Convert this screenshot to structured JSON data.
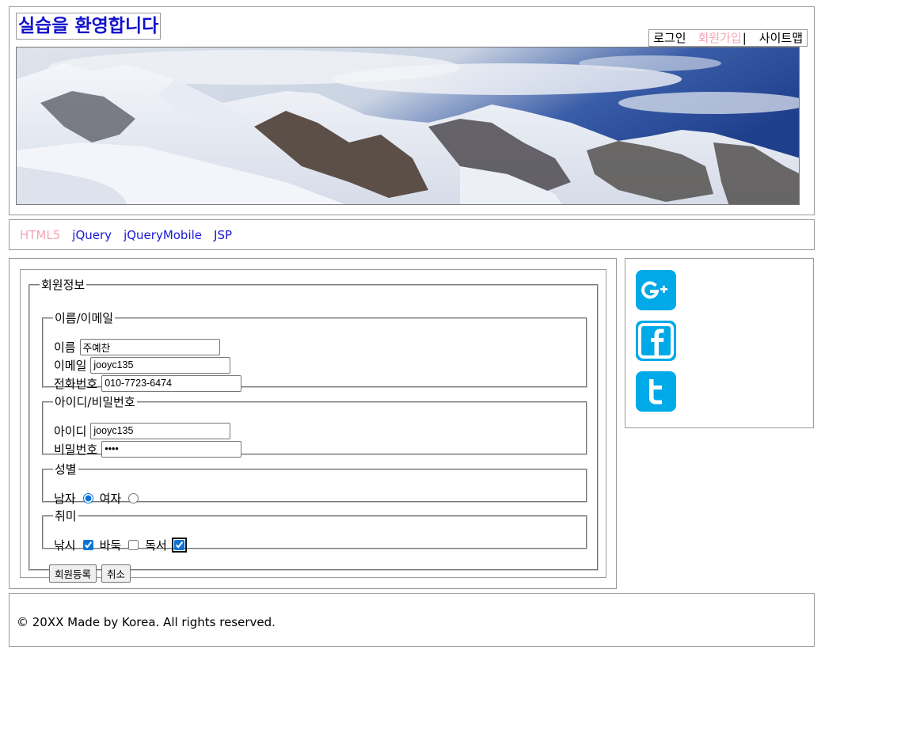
{
  "header": {
    "title": "실습을 환영합니다",
    "top_menu": {
      "login": "로그인",
      "join": "회원가입",
      "separator": "|",
      "sitemap": "사이트맵"
    }
  },
  "nav": {
    "items": [
      "HTML5",
      "jQuery",
      "jQueryMobile",
      "JSP"
    ],
    "active_index": 0
  },
  "form": {
    "legend": "회원정보",
    "name_email": {
      "legend": "이름/이메일",
      "name_label": "이름",
      "name_value": "주예찬",
      "email_label": "이메일",
      "email_value": "jooyc135",
      "phone_label": "전화번호",
      "phone_value": "010-7723-6474"
    },
    "account": {
      "legend": "아이디/비밀번호",
      "id_label": "아이디",
      "id_value": "jooyc135",
      "pw_label": "비밀번호",
      "pw_value": "1234"
    },
    "gender": {
      "legend": "성별",
      "male": "남자",
      "female": "여자",
      "selected": "male"
    },
    "hobby": {
      "legend": "취미",
      "fishing": "낚시",
      "baduk": "바둑",
      "reading": "독서",
      "checked": [
        "fishing",
        "reading"
      ]
    },
    "buttons": {
      "submit": "회원등록",
      "cancel": "취소"
    }
  },
  "aside": {
    "icons": [
      "google-plus-icon",
      "facebook-icon",
      "twitter-icon"
    ],
    "icon_color": "#00a9e8"
  },
  "footer": {
    "text": "© 20XX Made by Korea. All rights reserved."
  },
  "colors": {
    "title": "#1212cc",
    "nav_link": "#1a1ad6",
    "active_link": "#f4a5b5"
  }
}
